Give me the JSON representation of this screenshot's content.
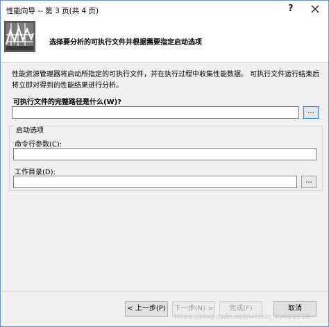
{
  "window": {
    "title": "性能向导 -- 第 3 页(共 4 页)",
    "help_glyph": "?",
    "close_glyph": "✕"
  },
  "banner": {
    "heading": "选择要分析的可执行文件并根据需要指定启动选项",
    "icon": "performance-chart-icon"
  },
  "description": "性能资源管理器将启动所指定的可执行文件，并在执行过程中收集性能数据。 可执行文件运行结束后将立即对得到的性能结果进行分析。",
  "executable": {
    "label": "可执行文件的完整路径是什么(W)?",
    "value": "",
    "browse_label": "..."
  },
  "launch_options": {
    "group_title": "启动选项",
    "args_label": "命令行参数(C):",
    "args_value": "",
    "workdir_label": "工作目录(D):",
    "workdir_value": "",
    "browse_label": "..."
  },
  "buttons": {
    "back": "< 上一步(P)",
    "next": "下一步(N) >",
    "finish": "完成(F)",
    "cancel": "取消"
  },
  "watermark": "https://blog.csdn.net/weixin_39603590"
}
